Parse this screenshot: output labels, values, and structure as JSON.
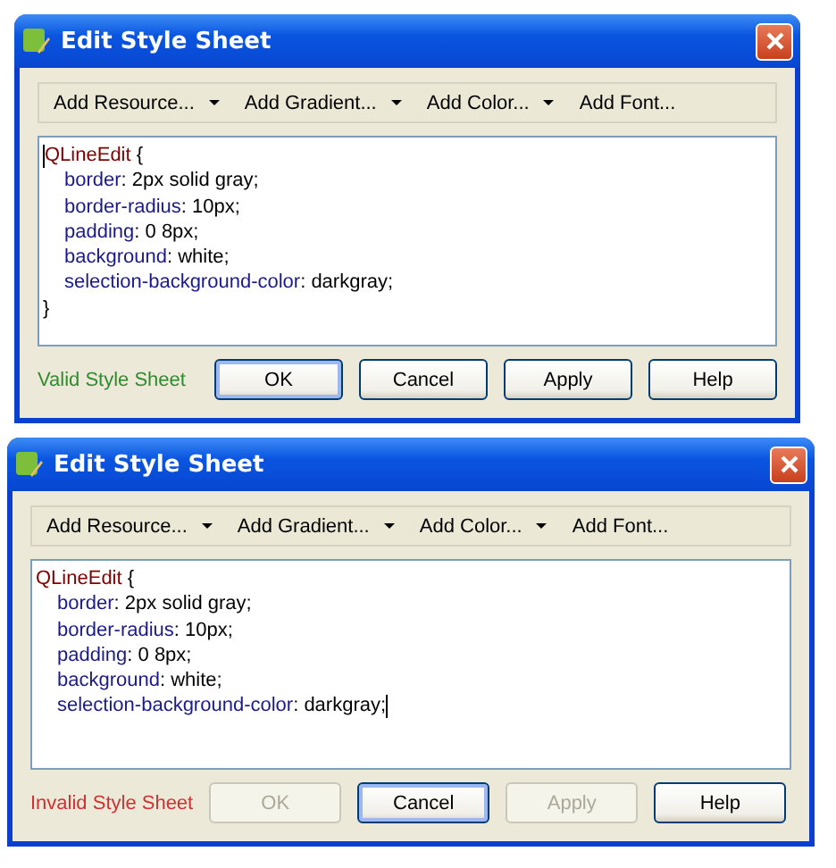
{
  "dialogs": [
    {
      "title": "Edit Style Sheet",
      "toolbar": [
        {
          "label": "Add Resource...",
          "has_menu": true
        },
        {
          "label": "Add Gradient...",
          "has_menu": true
        },
        {
          "label": "Add Color...",
          "has_menu": true
        },
        {
          "label": "Add Font...",
          "has_menu": false
        }
      ],
      "cursor_at_end": false,
      "code": [
        {
          "kind": "open",
          "selector": "QLineEdit",
          "brace": "{"
        },
        {
          "kind": "decl",
          "property": "border",
          "separator": ":",
          "value": "2px solid gray;"
        },
        {
          "kind": "decl",
          "property": "border-radius",
          "separator": ":",
          "value": "10px;"
        },
        {
          "kind": "decl",
          "property": "padding",
          "separator": ":",
          "value": "0 8px;"
        },
        {
          "kind": "decl",
          "property": "background",
          "separator": ":",
          "value": "white;"
        },
        {
          "kind": "decl",
          "property": "selection-background-color",
          "separator": ":",
          "value": "darkgray;"
        },
        {
          "kind": "close",
          "brace": "}"
        }
      ],
      "status": {
        "text": "Valid Style Sheet",
        "valid": true
      },
      "buttons": [
        {
          "label": "OK",
          "disabled": false,
          "focused": true
        },
        {
          "label": "Cancel",
          "disabled": false,
          "focused": false
        },
        {
          "label": "Apply",
          "disabled": false,
          "focused": false
        },
        {
          "label": "Help",
          "disabled": false,
          "focused": false
        }
      ]
    },
    {
      "title": "Edit Style Sheet",
      "toolbar": [
        {
          "label": "Add Resource...",
          "has_menu": true
        },
        {
          "label": "Add Gradient...",
          "has_menu": true
        },
        {
          "label": "Add Color...",
          "has_menu": true
        },
        {
          "label": "Add Font...",
          "has_menu": false
        }
      ],
      "cursor_at_end": true,
      "code": [
        {
          "kind": "open",
          "selector": "QLineEdit",
          "brace": "{"
        },
        {
          "kind": "decl",
          "property": "border",
          "separator": ":",
          "value": "2px solid gray;"
        },
        {
          "kind": "decl",
          "property": "border-radius",
          "separator": ":",
          "value": "10px;"
        },
        {
          "kind": "decl",
          "property": "padding",
          "separator": ":",
          "value": "0 8px;"
        },
        {
          "kind": "decl",
          "property": "background",
          "separator": ":",
          "value": "white;"
        },
        {
          "kind": "decl",
          "property": "selection-background-color",
          "separator": ":",
          "value": "darkgray;"
        }
      ],
      "status": {
        "text": "Invalid Style Sheet",
        "valid": false
      },
      "buttons": [
        {
          "label": "OK",
          "disabled": true,
          "focused": false
        },
        {
          "label": "Cancel",
          "disabled": false,
          "focused": true
        },
        {
          "label": "Apply",
          "disabled": true,
          "focused": false
        },
        {
          "label": "Help",
          "disabled": false,
          "focused": false
        }
      ]
    }
  ]
}
